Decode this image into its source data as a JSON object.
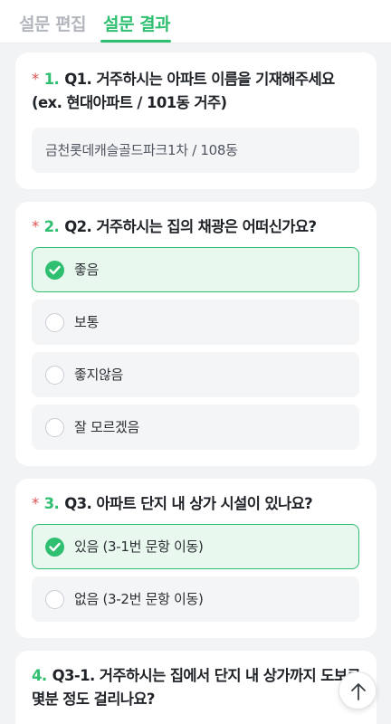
{
  "tabs": [
    {
      "label": "설문 편집",
      "active": false
    },
    {
      "label": "설문 결과",
      "active": true
    }
  ],
  "colors": {
    "accent": "#2fbf71",
    "required": "#e05252",
    "inactive_tab": "#b3b7bd"
  },
  "questions": [
    {
      "required_mark": "*",
      "number": "1.",
      "title": "Q1. 거주하시는 아파트 이름을 기재해주세요 (ex. 현대아파트 / 101동 거주)",
      "answer": "금천롯데캐슬골드파크1차 / 108동"
    },
    {
      "required_mark": "*",
      "number": "2.",
      "title": "Q2. 거주하시는 집의 채광은 어떠신가요?",
      "options": [
        {
          "label": "좋음",
          "selected": true
        },
        {
          "label": "보통",
          "selected": false
        },
        {
          "label": "좋지않음",
          "selected": false
        },
        {
          "label": "잘 모르겠음",
          "selected": false
        }
      ]
    },
    {
      "required_mark": "*",
      "number": "3.",
      "title": "Q3. 아파트 단지 내 상가 시설이 있나요?",
      "options": [
        {
          "label": "있음 (3-1번 문항 이동)",
          "selected": true
        },
        {
          "label": "없음 (3-2번 문항 이동)",
          "selected": false
        }
      ]
    },
    {
      "number": "4.",
      "title": "Q3-1. 거주하시는 집에서 단지 내 상가까지 도보로 몇분 정도 걸리나요?"
    }
  ],
  "icons": {
    "check": "check-icon",
    "scroll_top": "arrow-up-icon"
  }
}
